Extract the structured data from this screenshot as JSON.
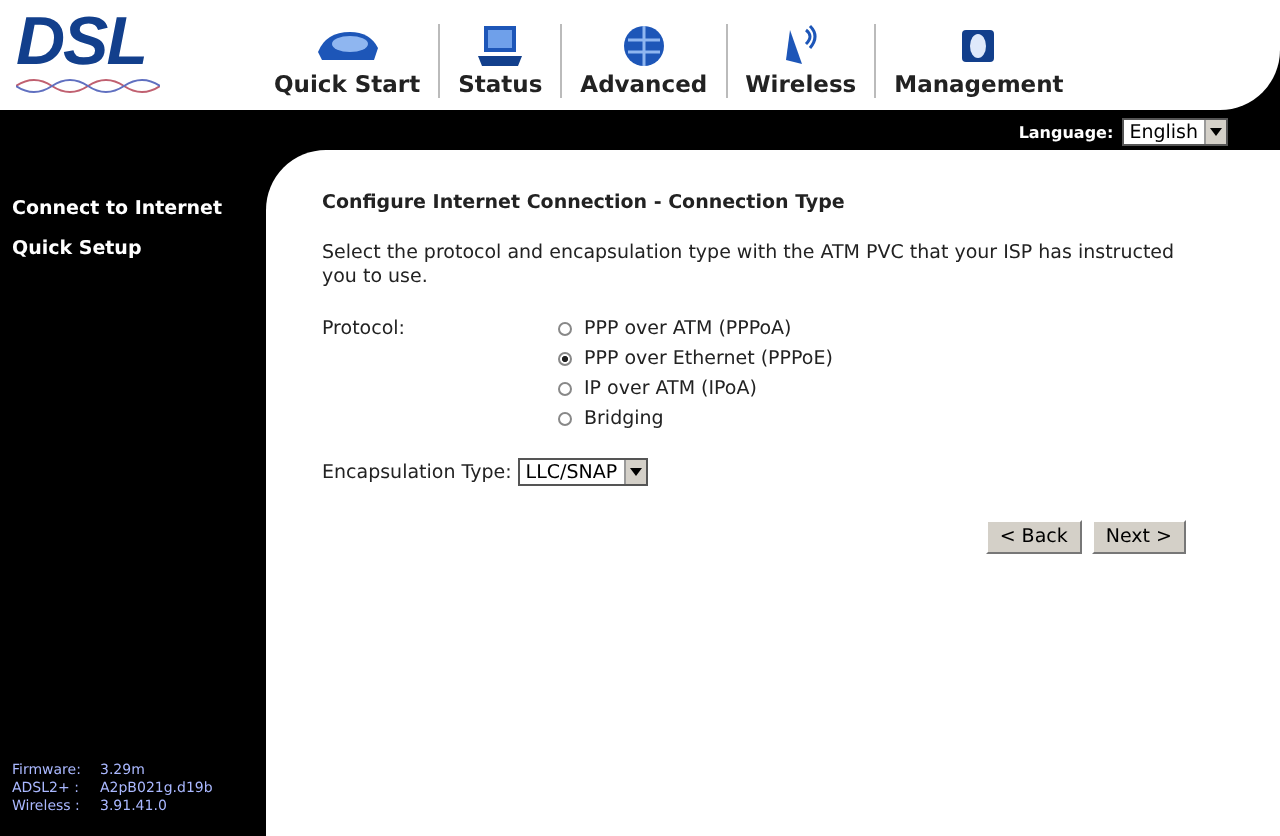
{
  "logo": {
    "text": "DSL"
  },
  "nav": [
    {
      "label": "Quick Start",
      "kind": "quickstart"
    },
    {
      "label": "Status",
      "kind": "status"
    },
    {
      "label": "Advanced",
      "kind": "advanced"
    },
    {
      "label": "Wireless",
      "kind": "wireless"
    },
    {
      "label": "Management",
      "kind": "management"
    }
  ],
  "language": {
    "label": "Language:",
    "value": "English"
  },
  "sidebar": {
    "items": [
      {
        "label": "Connect to Internet"
      },
      {
        "label": "Quick Setup"
      }
    ],
    "versions": [
      {
        "label": "Firmware:",
        "value": "3.29m"
      },
      {
        "label": "ADSL2+ :",
        "value": "A2pB021g.d19b"
      },
      {
        "label": "Wireless :",
        "value": "3.91.41.0"
      }
    ]
  },
  "content": {
    "title": "Configure Internet Connection - Connection Type",
    "intro": "Select the protocol and encapsulation type with the ATM PVC that your ISP has instructed you to use.",
    "protocol_label": "Protocol:",
    "protocols": [
      {
        "label": "PPP over ATM (PPPoA)",
        "selected": false
      },
      {
        "label": "PPP over Ethernet (PPPoE)",
        "selected": true
      },
      {
        "label": "IP over ATM (IPoA)",
        "selected": false
      },
      {
        "label": "Bridging",
        "selected": false
      }
    ],
    "encapsulation": {
      "label": "Encapsulation Type:",
      "value": "LLC/SNAP"
    },
    "buttons": [
      "< Back",
      "Next >"
    ]
  }
}
